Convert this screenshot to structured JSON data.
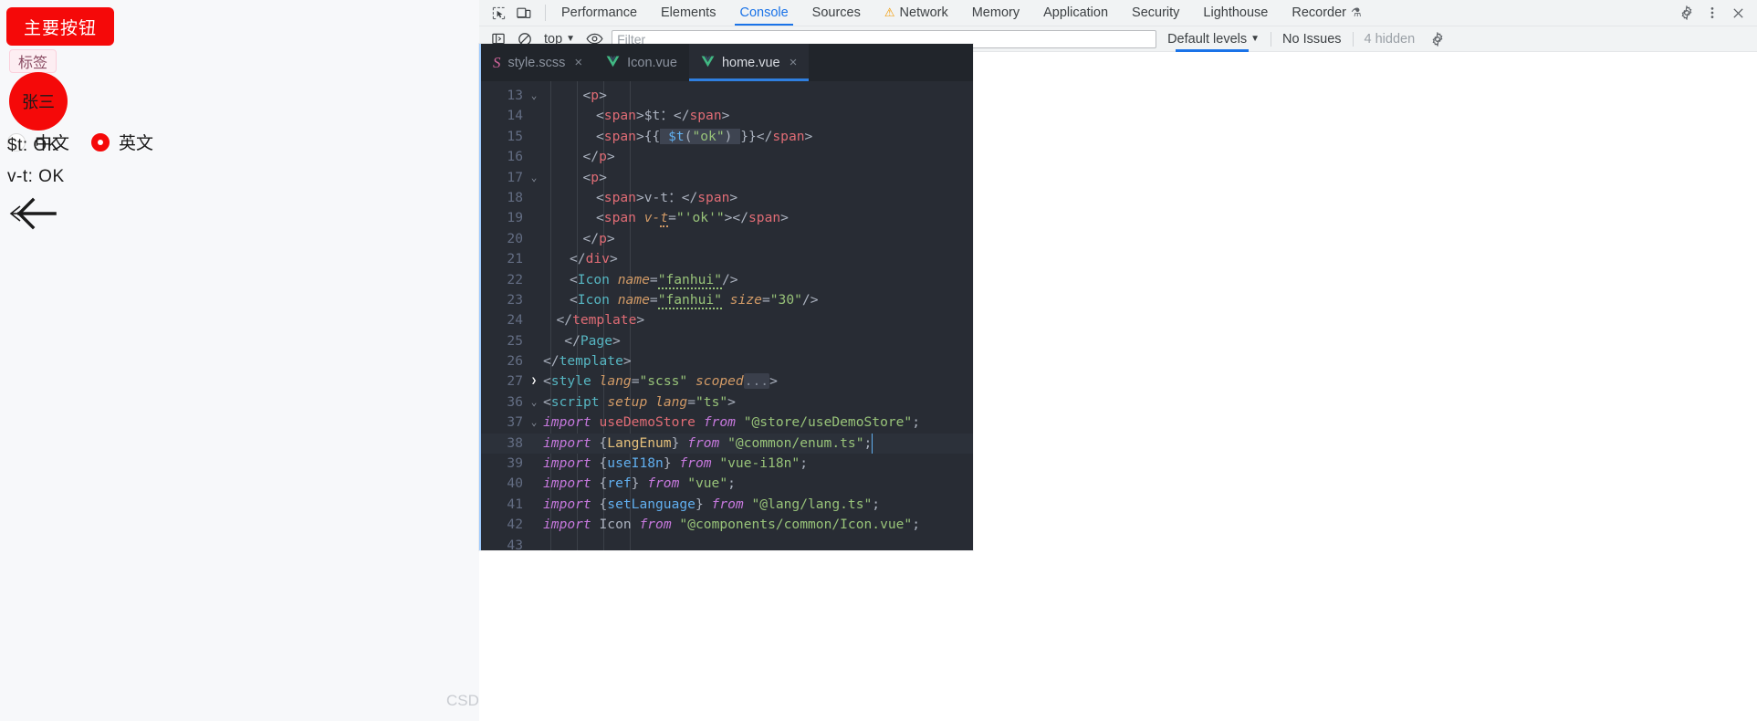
{
  "preview": {
    "primary_button_label": "主要按钮",
    "tag_label": "标签",
    "avatar_label": "张三",
    "radios": [
      {
        "label": "中文",
        "checked": false
      },
      {
        "label": "英文",
        "checked": true
      }
    ],
    "kv_lines": [
      "$t: OK",
      "v-t: OK"
    ],
    "back_icon_name": "back-arrow-icon",
    "watermark": "CSDN @局外人LZ",
    "accent_color": "#f50909"
  },
  "devtools": {
    "icons": {
      "inspect": "inspect-element-icon",
      "device": "device-toolbar-icon",
      "sidebar": "show-console-sidebar-icon",
      "clear": "clear-console-icon",
      "eye": "live-expression-eye-icon",
      "settings": "gear-icon",
      "more": "more-options-icon",
      "close": "close-icon"
    },
    "tabs": [
      {
        "label": "Performance",
        "active": false,
        "warning": false
      },
      {
        "label": "Elements",
        "active": false,
        "warning": false
      },
      {
        "label": "Console",
        "active": true,
        "warning": false
      },
      {
        "label": "Sources",
        "active": false,
        "warning": false
      },
      {
        "label": "Network",
        "active": false,
        "warning": true
      },
      {
        "label": "Memory",
        "active": false,
        "warning": false
      },
      {
        "label": "Application",
        "active": false,
        "warning": false
      },
      {
        "label": "Security",
        "active": false,
        "warning": false
      },
      {
        "label": "Lighthouse",
        "active": false,
        "warning": false
      },
      {
        "label": "Recorder",
        "active": false,
        "warning": false
      }
    ],
    "recorder_badge": "flask-icon",
    "filter_bar": {
      "context_label": "top",
      "filter_placeholder": "Filter",
      "filter_value": "",
      "levels_label": "Default levels",
      "issues_label": "No Issues",
      "hidden_label": "4 hidden"
    },
    "accent_color": "#1a73e8"
  },
  "editor": {
    "tabs": [
      {
        "label": "style.scss",
        "icon": "sass-file-icon",
        "active": false,
        "closable": true
      },
      {
        "label": "Icon.vue",
        "icon": "vue-file-icon",
        "active": false,
        "closable": false
      },
      {
        "label": "home.vue",
        "icon": "vue-file-icon",
        "active": true,
        "closable": true
      }
    ],
    "code_lines": [
      {
        "n": "13",
        "fold": "open",
        "indent": 3,
        "html": "&lt;<span class='tag'>p</span>&gt;"
      },
      {
        "n": "14",
        "fold": "",
        "indent": 4,
        "html": "&lt;<span class='tag'>span</span>&gt;$t：&lt;/<span class='tag'>span</span>&gt;"
      },
      {
        "n": "15",
        "fold": "",
        "indent": 4,
        "html": "&lt;<span class='tag'>span</span>&gt;{{<span class='sel-hl'> <span class='fn'>$t</span>(<span class='str'>\"ok\"</span>) </span>}}&lt;/<span class='tag'>span</span>&gt;"
      },
      {
        "n": "16",
        "fold": "",
        "indent": 3,
        "html": "&lt;/<span class='tag'>p</span>&gt;"
      },
      {
        "n": "17",
        "fold": "open",
        "indent": 3,
        "html": "&lt;<span class='tag'>p</span>&gt;"
      },
      {
        "n": "18",
        "fold": "",
        "indent": 4,
        "html": "&lt;<span class='tag'>span</span>&gt;v-t：&lt;/<span class='tag'>span</span>&gt;"
      },
      {
        "n": "19",
        "fold": "",
        "indent": 4,
        "html": "&lt;<span class='tag'>span</span> <span class='attr'>v-<span class='squig-y'>t</span></span>=<span class='str'>\"'ok'\"</span>&gt;&lt;/<span class='tag'>span</span>&gt;"
      },
      {
        "n": "20",
        "fold": "",
        "indent": 3,
        "html": "&lt;/<span class='tag'>p</span>&gt;"
      },
      {
        "n": "21",
        "fold": "",
        "indent": 2,
        "html": "&lt;/<span class='tag'>div</span>&gt;"
      },
      {
        "n": "22",
        "fold": "",
        "indent": 2,
        "html": "&lt;<span class='tag2'>Icon</span> <span class='attr'>name</span>=<span class='str'><span class='squig'>\"fanhui\"</span></span>/&gt;"
      },
      {
        "n": "23",
        "fold": "",
        "indent": 2,
        "html": "&lt;<span class='tag2'>Icon</span> <span class='attr'>name</span>=<span class='str'><span class='squig'>\"fanhui\"</span></span> <span class='attr'>size</span>=<span class='str'>\"30\"</span>/&gt;"
      },
      {
        "n": "24",
        "fold": "",
        "indent": 1,
        "html": "&lt;/<span class='tag'>template</span>&gt;"
      },
      {
        "n": "25",
        "fold": "",
        "indent": 1,
        "html": "&nbsp;&lt;/<span class='tag2'>Page</span>&gt;"
      },
      {
        "n": "26",
        "fold": "",
        "indent": 0,
        "html": "&lt;/<span class='tag2'>template</span>&gt;"
      },
      {
        "n": "27",
        "fold": "closed",
        "indent": 0,
        "html": "&lt;<span class='tag2'>style</span> <span class='attr'>lang</span>=<span class='str'>\"scss\"</span> <span class='attr'>scoped</span><span class='fold-ellipsis'>...</span>&gt;"
      },
      {
        "n": "36",
        "fold": "open",
        "indent": 0,
        "html": "&lt;<span class='tag2'>script</span> <span class='attr'>setup</span> <span class='attr'>lang</span>=<span class='str'>\"ts\"</span>&gt;"
      },
      {
        "n": "37",
        "fold": "open",
        "indent": 0,
        "html": "<span class='kw'>import</span> <span class='tag'>useDemoStore</span> <span class='kw'>from</span> <span class='str'>\"@store/useDemoStore\"</span>;"
      },
      {
        "n": "38",
        "fold": "",
        "hl": true,
        "indent": 0,
        "html": "<span class='kw'>import</span> {<span class='mut'>LangEnum</span>} <span class='kw'>from</span> <span class='str'>\"@common/enum.ts\"</span>;<span class='caret'>|</span>"
      },
      {
        "n": "39",
        "fold": "",
        "indent": 0,
        "html": "<span class='kw'>import</span> {<span class='fn'>useI18n</span>} <span class='kw'>from</span> <span class='str'>\"vue-i18n\"</span>;"
      },
      {
        "n": "40",
        "fold": "",
        "indent": 0,
        "html": "<span class='kw'>import</span> {<span class='fn'>ref</span>} <span class='kw'>from</span> <span class='str'>\"vue\"</span>;"
      },
      {
        "n": "41",
        "fold": "",
        "indent": 0,
        "html": "<span class='kw'>import</span> {<span class='fn'>setLanguage</span>} <span class='kw'>from</span> <span class='str'>\"@lang/lang.ts\"</span>;"
      },
      {
        "n": "42",
        "fold": "",
        "indent": 0,
        "html": "<span class='kw'>import</span> <span class='grey'>Icon</span> <span class='kw'>from</span> <span class='str'>\"@components/common/Icon.vue\"</span>;"
      },
      {
        "n": "43",
        "fold": "",
        "indent": 0,
        "html": ""
      }
    ]
  }
}
